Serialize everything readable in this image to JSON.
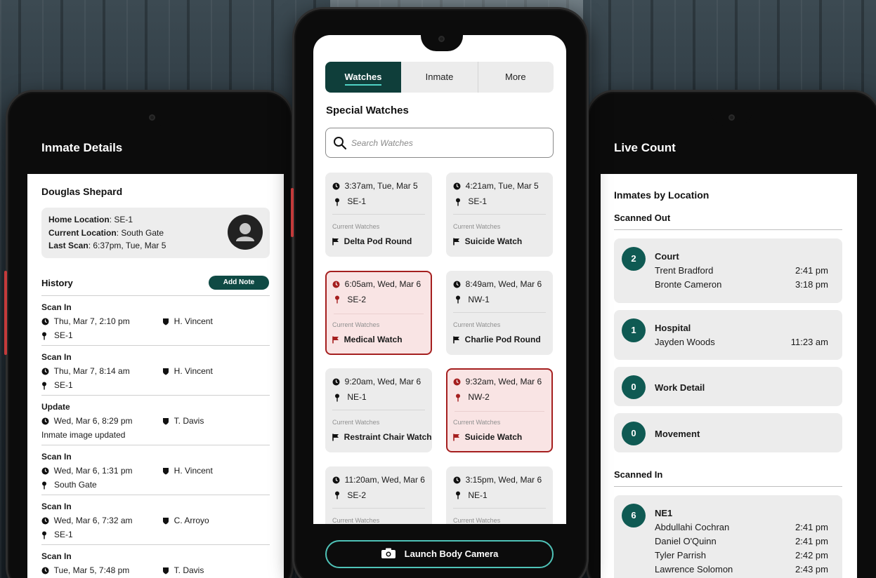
{
  "colors": {
    "brand_dark": "#0f3e3a",
    "badge": "#0f5a53",
    "alert_border": "#a51f1f",
    "alert_bg": "#f9e4e4",
    "accent": "#4fc3b8"
  },
  "left_phone": {
    "header_title": "Inmate Details",
    "inmate_name": "Douglas Shepard",
    "home_location_label": "Home Location",
    "home_location": ": SE-1",
    "current_location_label": "Current Location",
    "current_location": ": South Gate",
    "last_scan_label": "Last Scan",
    "last_scan": ": 6:37pm, Tue, Mar 5",
    "history_title": "History",
    "add_note_label": "Add Note",
    "history": [
      {
        "type": "Scan In",
        "time": "Thu, Mar 7, 2:10 pm",
        "officer": "H. Vincent",
        "detail": "SE-1",
        "detail_icon": "pin-icon"
      },
      {
        "type": "Scan In",
        "time": "Thu, Mar 7, 8:14 am",
        "officer": "H. Vincent",
        "detail": "SE-1",
        "detail_icon": "pin-icon"
      },
      {
        "type": "Update",
        "time": "Wed, Mar 6, 8:29 pm",
        "officer": "T. Davis",
        "detail": "Inmate image updated",
        "detail_icon": "none"
      },
      {
        "type": "Scan In",
        "time": "Wed, Mar 6, 1:31 pm",
        "officer": "H. Vincent",
        "detail": "South Gate",
        "detail_icon": "pin-icon"
      },
      {
        "type": "Scan In",
        "time": "Wed, Mar 6, 7:32 am",
        "officer": "C. Arroyo",
        "detail": "SE-1",
        "detail_icon": "pin-icon"
      },
      {
        "type": "Scan In",
        "time": "Tue, Mar 5, 7:48 pm",
        "officer": "T. Davis",
        "detail": "",
        "detail_icon": "pin-icon"
      }
    ]
  },
  "center_phone": {
    "tabs": [
      {
        "label": "Watches",
        "active": true
      },
      {
        "label": "Inmate",
        "active": false
      },
      {
        "label": "More",
        "active": false
      }
    ],
    "section_title": "Special Watches",
    "search_placeholder": "Search Watches",
    "current_watches_label": "Current Watches",
    "watches": [
      {
        "time": "3:37am, Tue, Mar 5",
        "location": "SE-1",
        "watch": "Delta Pod Round",
        "alert": false
      },
      {
        "time": "4:21am, Tue, Mar 5",
        "location": "SE-1",
        "watch": "Suicide Watch",
        "alert": false
      },
      {
        "time": "6:05am, Wed, Mar 6",
        "location": "SE-2",
        "watch": "Medical Watch",
        "alert": true
      },
      {
        "time": "8:49am, Wed, Mar 6",
        "location": "NW-1",
        "watch": "Charlie Pod Round",
        "alert": false
      },
      {
        "time": "9:20am, Wed, Mar 6",
        "location": "NE-1",
        "watch": "Restraint Chair Watch",
        "alert": false
      },
      {
        "time": "9:32am, Wed, Mar 6",
        "location": "NW-2",
        "watch": "Suicide Watch",
        "alert": true
      },
      {
        "time": "11:20am, Wed, Mar 6",
        "location": "SE-2",
        "watch": "",
        "alert": false
      },
      {
        "time": "3:15pm, Wed, Mar 6",
        "location": "NE-1",
        "watch": "",
        "alert": false
      }
    ],
    "launch_label": "Launch Body Camera"
  },
  "right_phone": {
    "header_title": "Live Count",
    "title": "Inmates by Location",
    "scanned_out_label": "Scanned Out",
    "scanned_in_label": "Scanned In",
    "scanned_out": [
      {
        "count": "2",
        "name": "Court",
        "people": [
          {
            "name": "Trent Bradford",
            "time": "2:41 pm"
          },
          {
            "name": "Bronte Cameron",
            "time": "3:18 pm"
          }
        ]
      },
      {
        "count": "1",
        "name": "Hospital",
        "people": [
          {
            "name": "Jayden Woods",
            "time": "11:23 am"
          }
        ]
      },
      {
        "count": "0",
        "name": "Work Detail",
        "people": []
      },
      {
        "count": "0",
        "name": "Movement",
        "people": []
      }
    ],
    "scanned_in": [
      {
        "count": "6",
        "name": "NE1",
        "people": [
          {
            "name": "Abdullahi Cochran",
            "time": "2:41 pm"
          },
          {
            "name": "Daniel O'Quinn",
            "time": "2:41 pm"
          },
          {
            "name": "Tyler Parrish",
            "time": "2:42 pm"
          },
          {
            "name": "Lawrence Solomon",
            "time": "2:43 pm"
          }
        ]
      }
    ]
  }
}
